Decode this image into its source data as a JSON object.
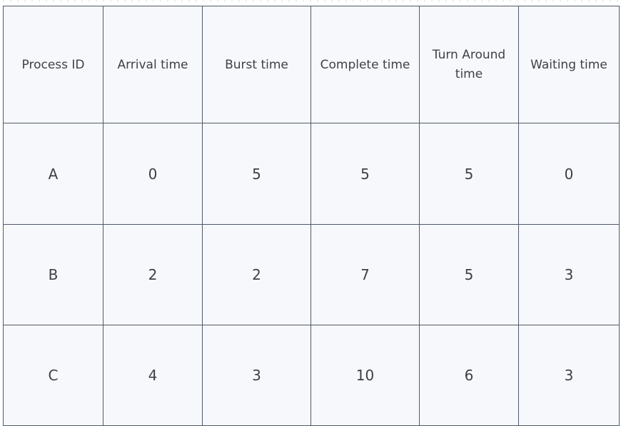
{
  "table": {
    "headers": [
      "Process ID",
      "Arrival time",
      "Burst time",
      "Complete time",
      "Turn Around time",
      "Waiting time"
    ],
    "rows": [
      [
        "A",
        "0",
        "5",
        "5",
        "5",
        "0"
      ],
      [
        "B",
        "2",
        "2",
        "7",
        "5",
        "3"
      ],
      [
        "C",
        "4",
        "3",
        "10",
        "6",
        "3"
      ]
    ]
  }
}
